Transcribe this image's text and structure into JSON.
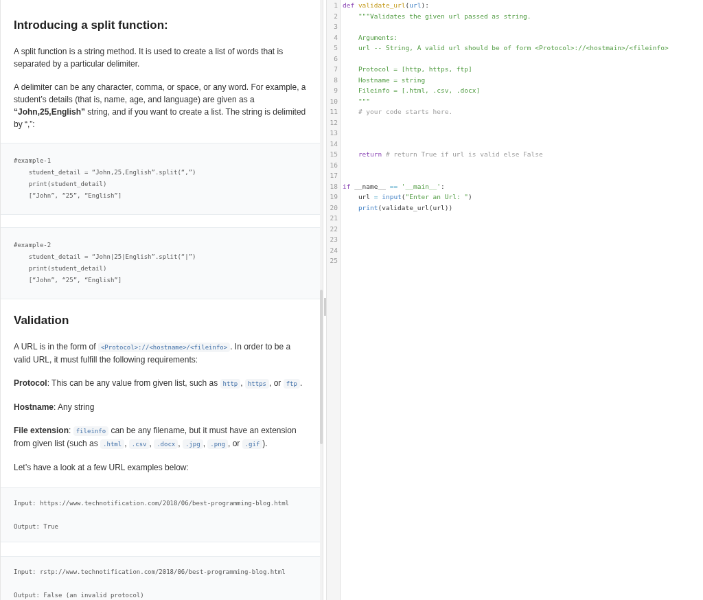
{
  "article": {
    "blocks": [
      {
        "kind": "heading",
        "text": "Introducing a split function:"
      },
      {
        "kind": "paragraph",
        "segments": [
          {
            "kind": "text",
            "text": "A split function is a string method. It is used to create a list of words that is separated by a particular delimiter."
          }
        ]
      },
      {
        "kind": "paragraph",
        "segments": [
          {
            "kind": "text",
            "text": "A delimiter can be any character, comma, or space, or any word. For example, a student’s details (that is, name, age, and language) are given as a **“John,25,English”** string, and if you want to create a list. The string is delimited by “,”:"
          }
        ]
      },
      {
        "kind": "code",
        "lines": [
          "#example-1",
          "    student_detail = “John,25,English”.split(“,”)",
          "    print(student_detail)",
          "    [“John”, “25”, “English”]"
        ]
      },
      {
        "kind": "code",
        "lines": [
          "#example-2",
          "    student_detail = “John|25|English”.split(“|”)",
          "    print(student_detail)",
          "    [“John”, “25”, “English”]"
        ]
      },
      {
        "kind": "heading",
        "text": "Validation"
      },
      {
        "kind": "paragraph",
        "segments": [
          {
            "kind": "text",
            "text": "A URL is in the form of "
          },
          {
            "kind": "code",
            "text": "<Protocol>://<hostname>/<fileinfo>"
          },
          {
            "kind": "text",
            "text": ". In order to be a valid URL, it must fulfill the following requirements:"
          }
        ]
      },
      {
        "kind": "paragraph",
        "segments": [
          {
            "kind": "text",
            "text": "**Protocol**: This can be any value from given list, such as "
          },
          {
            "kind": "code",
            "text": "http"
          },
          {
            "kind": "text",
            "text": ", "
          },
          {
            "kind": "code",
            "text": "https"
          },
          {
            "kind": "text",
            "text": ", or "
          },
          {
            "kind": "code",
            "text": "ftp"
          },
          {
            "kind": "text",
            "text": "."
          }
        ]
      },
      {
        "kind": "paragraph",
        "segments": [
          {
            "kind": "text",
            "text": "**Hostname**: Any string"
          }
        ]
      },
      {
        "kind": "paragraph",
        "segments": [
          {
            "kind": "text",
            "text": "**File extension**: "
          },
          {
            "kind": "code",
            "text": "fileinfo"
          },
          {
            "kind": "text",
            "text": " can be any filename, but it must have an extension from given list (such as "
          },
          {
            "kind": "code",
            "text": ".html"
          },
          {
            "kind": "text",
            "text": ", "
          },
          {
            "kind": "code",
            "text": ".csv"
          },
          {
            "kind": "text",
            "text": ", "
          },
          {
            "kind": "code",
            "text": ".docx"
          },
          {
            "kind": "text",
            "text": ", "
          },
          {
            "kind": "code",
            "text": ".jpg"
          },
          {
            "kind": "text",
            "text": ", "
          },
          {
            "kind": "code",
            "text": ".png"
          },
          {
            "kind": "text",
            "text": ", or "
          },
          {
            "kind": "code",
            "text": ".gif"
          },
          {
            "kind": "text",
            "text": ")."
          }
        ]
      },
      {
        "kind": "paragraph",
        "segments": [
          {
            "kind": "text",
            "text": "Let’s have a look at a few URL examples below:"
          }
        ]
      },
      {
        "kind": "example",
        "lines": [
          "Input: https://www.technotification.com/2018/06/best-programming-blog.html",
          "Output: True"
        ]
      },
      {
        "kind": "example",
        "lines": [
          "Input: rstp://www.technotification.com/2018/06/best-programming-blog.html",
          "Output: False (an invalid protocol)"
        ]
      }
    ]
  },
  "editor": {
    "lines": [
      {
        "number": "1",
        "tokens": [
          {
            "kind": "keyword",
            "text": "def "
          },
          {
            "kind": "function",
            "text": "validate_url"
          },
          {
            "kind": "plain",
            "text": "("
          },
          {
            "kind": "param",
            "text": "url"
          },
          {
            "kind": "plain",
            "text": "):"
          }
        ]
      },
      {
        "number": "2",
        "tokens": [
          {
            "kind": "string",
            "text": "    \"\"\"Validates the given url passed as string."
          }
        ]
      },
      {
        "number": "3"
      },
      {
        "number": "4",
        "tokens": [
          {
            "kind": "string",
            "text": "    Arguments:"
          }
        ]
      },
      {
        "number": "5",
        "tokens": [
          {
            "kind": "string",
            "text": "    url -- String, A valid url should be of form <Protocol>://<hostmain>/<fileinfo>"
          }
        ]
      },
      {
        "number": "6"
      },
      {
        "number": "7",
        "tokens": [
          {
            "kind": "string",
            "text": "    Protocol = [http, https, ftp]"
          }
        ]
      },
      {
        "number": "8",
        "tokens": [
          {
            "kind": "string",
            "text": "    Hostname = string"
          }
        ]
      },
      {
        "number": "9",
        "tokens": [
          {
            "kind": "string",
            "text": "    Fileinfo = [.html, .csv, .docx]"
          }
        ]
      },
      {
        "number": "10",
        "tokens": [
          {
            "kind": "string",
            "text": "    \"\"\""
          }
        ]
      },
      {
        "number": "11",
        "tokens": [
          {
            "kind": "comment",
            "text": "    # your code starts here."
          }
        ]
      },
      {
        "number": "12"
      },
      {
        "number": "13"
      },
      {
        "number": "14"
      },
      {
        "number": "15",
        "tokens": [
          {
            "kind": "keyword",
            "text": "    return"
          },
          {
            "kind": "comment",
            "text": " # return True if url is valid else False"
          }
        ]
      },
      {
        "number": "16"
      },
      {
        "number": "17"
      },
      {
        "number": "18",
        "tokens": [
          {
            "kind": "keyword",
            "text": "if"
          },
          {
            "kind": "plain",
            "text": " __name__ "
          },
          {
            "kind": "operator",
            "text": "=="
          },
          {
            "kind": "string",
            "text": " '__main__'"
          },
          {
            "kind": "plain",
            "text": ":"
          }
        ]
      },
      {
        "number": "19",
        "tokens": [
          {
            "kind": "plain",
            "text": "    url "
          },
          {
            "kind": "operator",
            "text": "="
          },
          {
            "kind": "builtin",
            "text": " input"
          },
          {
            "kind": "plain",
            "text": "("
          },
          {
            "kind": "string",
            "text": "\"Enter an Url: \""
          },
          {
            "kind": "plain",
            "text": ")"
          }
        ]
      },
      {
        "number": "20",
        "tokens": [
          {
            "kind": "builtin",
            "text": "    print"
          },
          {
            "kind": "plain",
            "text": "(validate_url(url))"
          }
        ]
      },
      {
        "number": "21"
      },
      {
        "number": "22"
      },
      {
        "number": "23"
      },
      {
        "number": "24"
      },
      {
        "number": "25"
      }
    ]
  }
}
